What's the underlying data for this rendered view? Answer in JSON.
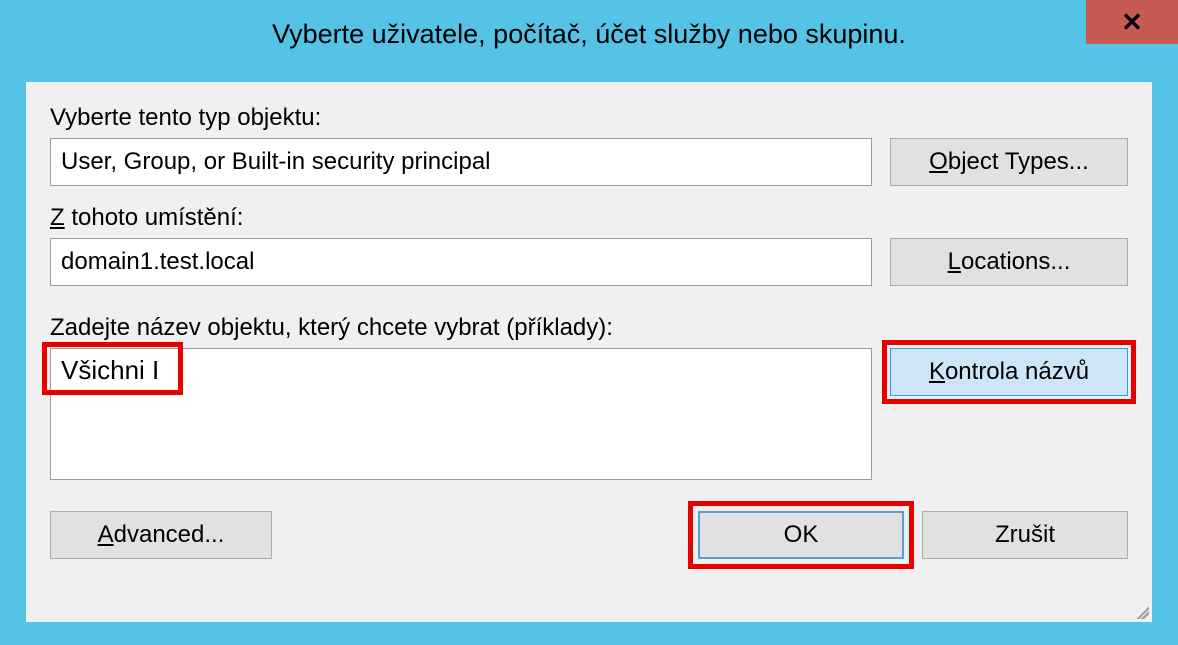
{
  "title": "Vyberte uživatele, počítač, účet služby nebo skupinu.",
  "close_glyph": "✕",
  "object_type": {
    "label": "Vyberte tento typ objektu:",
    "value": "User, Group, or Built-in security principal",
    "button": {
      "accel": "O",
      "rest": "bject Types..."
    }
  },
  "location": {
    "label_accel": "Z",
    "label_rest": " tohoto umístění:",
    "value": "domain1.test.local",
    "button": {
      "accel": "L",
      "rest": "ocations..."
    }
  },
  "object_name": {
    "label": "Zadejte název objektu, který chcete vybrat (příklady):",
    "value": "Všichni I",
    "button": {
      "accel": "K",
      "rest": "ontrola názvů"
    }
  },
  "advanced": {
    "accel": "A",
    "rest": "dvanced..."
  },
  "ok": "OK",
  "cancel": "Zrušit"
}
